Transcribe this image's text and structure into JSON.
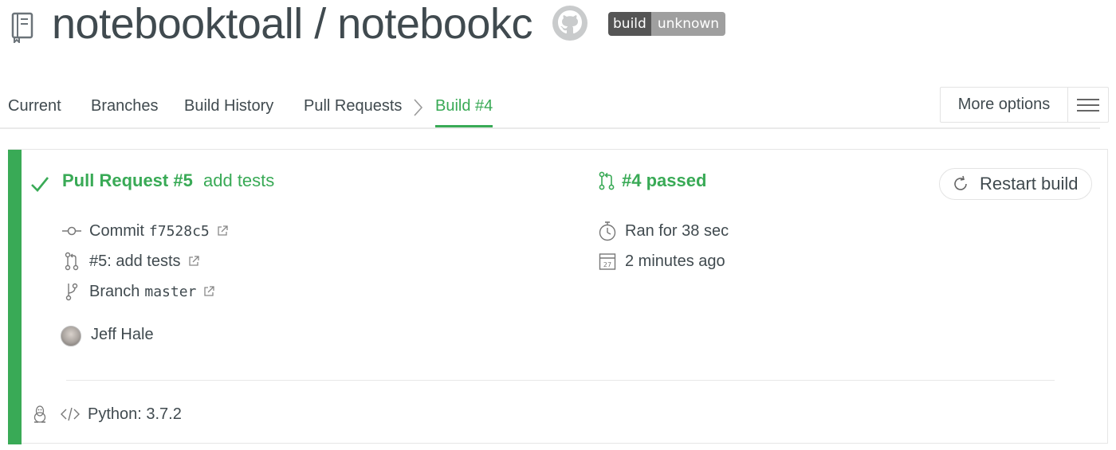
{
  "header": {
    "repo_title": "notebooktoall / notebookc",
    "badge_left": "build",
    "badge_right": "unknown",
    "icons": [
      "repo-icon",
      "github-icon"
    ]
  },
  "tabs": {
    "items": [
      {
        "label": "Current"
      },
      {
        "label": "Branches"
      },
      {
        "label": "Build History"
      },
      {
        "label": "Pull Requests"
      },
      {
        "label": "Build #4",
        "active": true
      }
    ],
    "more_options": "More options"
  },
  "build": {
    "status_color": "#39aa56",
    "pr_title": "Pull Request #5",
    "pr_message": "add tests",
    "commit_label": "Commit",
    "commit_sha": "f7528c5",
    "pr_link": "#5: add tests",
    "branch_label": "Branch",
    "branch_name": "master",
    "author": "Jeff Hale",
    "environment": "Python: 3.7.2",
    "result": "#4 passed",
    "duration": "Ran for 38 sec",
    "finished": "2 minutes ago",
    "calendar_day": "27",
    "restart_label": "Restart build"
  }
}
